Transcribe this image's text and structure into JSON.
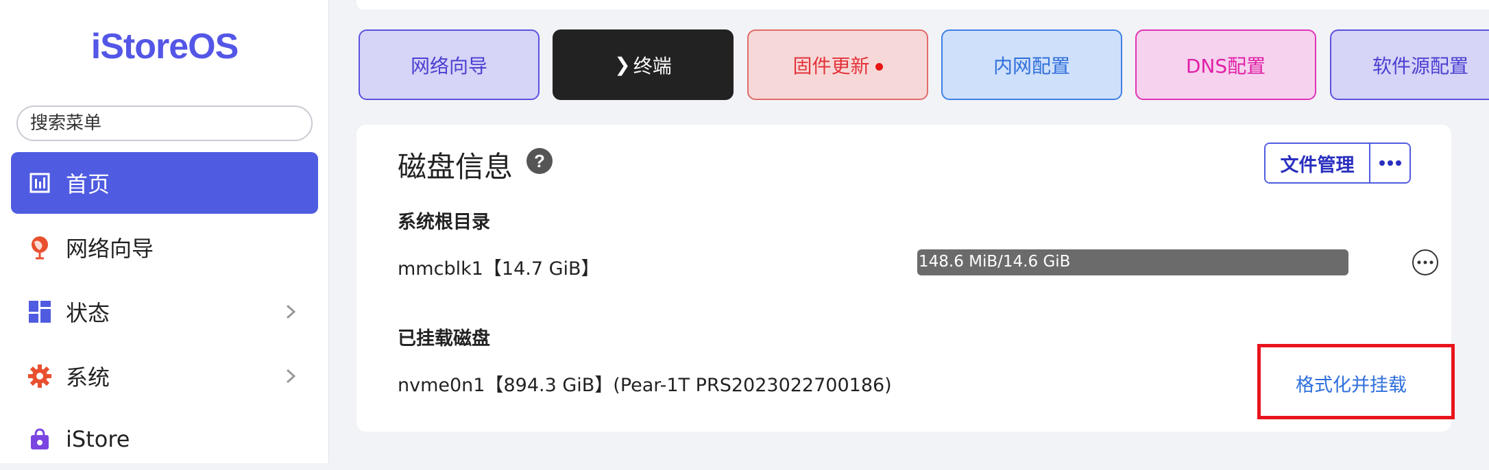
{
  "sidebar": {
    "logo": "iStoreOS",
    "search_placeholder": "搜索菜单",
    "items": [
      {
        "label": "首页",
        "icon": "dashboard-icon",
        "active": true
      },
      {
        "label": "网络向导",
        "icon": "globe-icon"
      },
      {
        "label": "状态",
        "icon": "grid-icon",
        "has_submenu": true
      },
      {
        "label": "系统",
        "icon": "gear-icon",
        "has_submenu": true
      },
      {
        "label": "iStore",
        "icon": "store-bag-icon"
      }
    ]
  },
  "quick_buttons": [
    {
      "label": "网络向导",
      "color": "#4a3fd1",
      "bg": "#d6d4f7",
      "border": "#5b51dd"
    },
    {
      "label": "终端",
      "prefix": "❯",
      "color": "#ffffff",
      "bg": "#222222",
      "border": "#222222"
    },
    {
      "label": "固件更新",
      "color": "#e3333a",
      "bg": "#f7d8d8",
      "border": "#e26a6a",
      "dot_color": "#e81515"
    },
    {
      "label": "内网配置",
      "color": "#2f6fdc",
      "bg": "#cfe0fa",
      "border": "#3d7fe6"
    },
    {
      "label": "DNS配置",
      "color": "#e11fa6",
      "bg": "#f6d2ee",
      "border": "#e033b6"
    },
    {
      "label": "软件源配置",
      "color": "#4a3fd1",
      "bg": "#d6d4f7",
      "border": "#5b51dd"
    }
  ],
  "disk_card": {
    "title": "磁盘信息",
    "help_symbol": "?",
    "file_manage_button": "文件管理",
    "root_section_title": "系统根目录",
    "root_disk": {
      "name": "mmcblk1【14.7 GiB】",
      "usage_label": "148.6 MiB/14.6 GiB",
      "usage_fraction": 0.01
    },
    "mounted_section_title": "已挂载磁盘",
    "mounted_disk": {
      "name": "nvme0n1【894.3 GiB】(Pear-1T PRS2023022700186)",
      "action": "格式化并挂载"
    }
  }
}
